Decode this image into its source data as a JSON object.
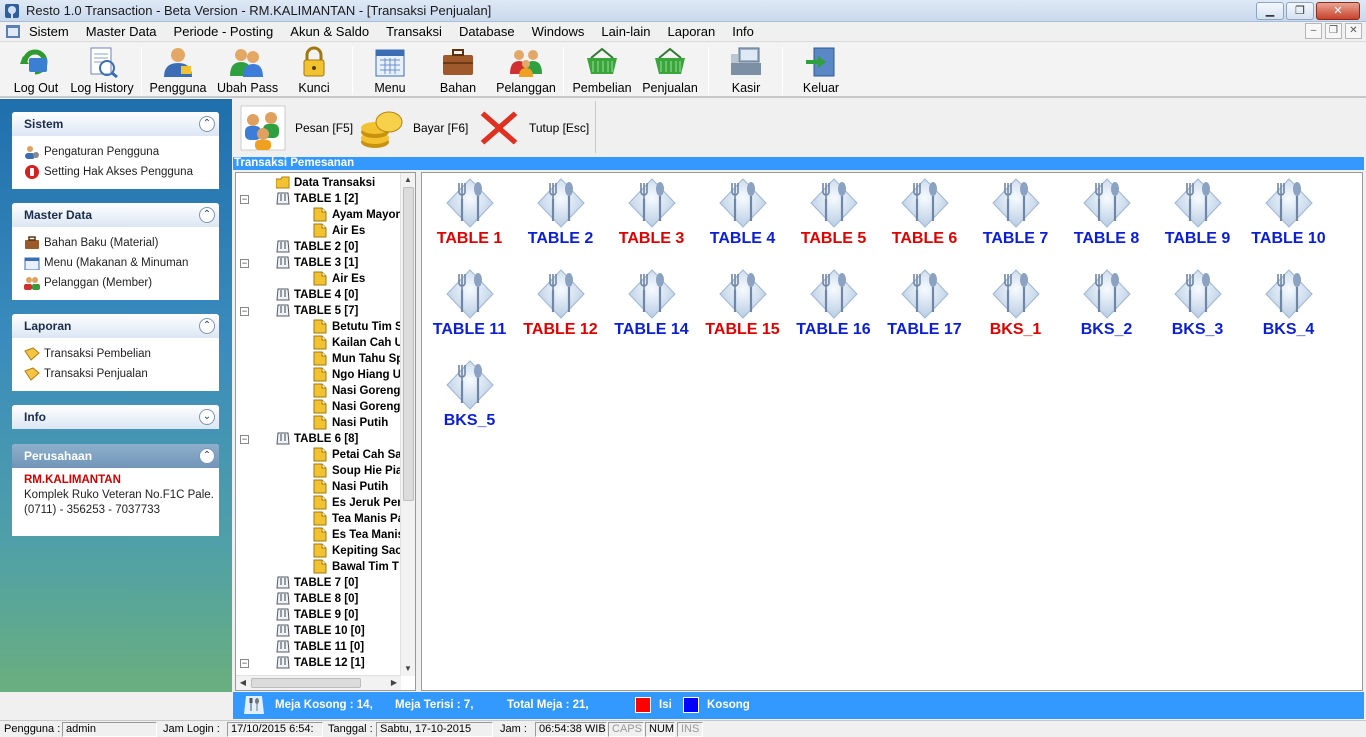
{
  "window": {
    "title": "Resto 1.0 Transaction - Beta Version - RM.KALIMANTAN - [Transaksi Penjualan]",
    "minimize": "▁",
    "maximize": "❐",
    "close": "✕"
  },
  "menu": {
    "items": [
      "Sistem",
      "Master Data",
      "Periode - Posting",
      "Akun & Saldo",
      "Transaksi",
      "Database",
      "Windows",
      "Lain-lain",
      "Laporan",
      "Info"
    ],
    "mdi_minimize": "–",
    "mdi_restore": "❐",
    "mdi_close": "✕"
  },
  "toolbar": {
    "buttons": [
      {
        "label": "Log Out",
        "icon": "logout-icon"
      },
      {
        "label": "Log History",
        "icon": "log-history-icon"
      },
      {
        "label": "Pengguna",
        "icon": "user-icon"
      },
      {
        "label": "Ubah Pass",
        "icon": "change-password-icon"
      },
      {
        "label": "Kunci",
        "icon": "lock-icon"
      },
      {
        "label": "Menu",
        "icon": "calendar-icon"
      },
      {
        "label": "Bahan",
        "icon": "briefcase-icon"
      },
      {
        "label": "Pelanggan",
        "icon": "customers-icon"
      },
      {
        "label": "Pembelian",
        "icon": "basket-icon"
      },
      {
        "label": "Penjualan",
        "icon": "basket-icon"
      },
      {
        "label": "Kasir",
        "icon": "cashier-icon"
      },
      {
        "label": "Keluar",
        "icon": "exit-door-icon"
      }
    ]
  },
  "sidebar": {
    "sistem": {
      "title": "Sistem",
      "chevron": "⌃",
      "items": [
        "Pengaturan Pengguna",
        "Setting Hak Akses Pengguna"
      ]
    },
    "master": {
      "title": "Master Data",
      "chevron": "⌃",
      "items": [
        "Bahan Baku (Material)",
        "Menu (Makanan & Minuman",
        "Pelanggan (Member)"
      ]
    },
    "laporan": {
      "title": "Laporan",
      "chevron": "⌃",
      "items": [
        "Transaksi Pembelian",
        "Transaksi Penjualan"
      ]
    },
    "info": {
      "title": "Info",
      "chevron": "⌄"
    },
    "perusahaan": {
      "title": "Perusahaan",
      "chevron": "⌃",
      "name": "RM.KALIMANTAN",
      "address": "Komplek Ruko Veteran No.F1C Pale...",
      "phone": "(0711) - 356253 - 7037733"
    }
  },
  "actions": {
    "pesan": "Pesan [F5]",
    "bayar": "Bayar [F6]",
    "tutup": "Tutup [Esc]"
  },
  "section_title": "Transaksi Pemesanan",
  "tree": {
    "root": "Data Transaksi",
    "rows": [
      {
        "label": "TABLE 1  [2]",
        "level": 1,
        "expander": "−"
      },
      {
        "label": "Ayam Mayon",
        "level": 2
      },
      {
        "label": "Air Es",
        "level": 2
      },
      {
        "label": "TABLE 2  [0]",
        "level": 1
      },
      {
        "label": "TABLE 3  [1]",
        "level": 1,
        "expander": "−"
      },
      {
        "label": "Air Es",
        "level": 2
      },
      {
        "label": "TABLE 4  [0]",
        "level": 1
      },
      {
        "label": "TABLE 5  [7]",
        "level": 1,
        "expander": "−"
      },
      {
        "label": "Betutu Tim S",
        "level": 2
      },
      {
        "label": "Kailan Cah U",
        "level": 2
      },
      {
        "label": "Mun Tahu Sp",
        "level": 2
      },
      {
        "label": "Ngo Hiang Ud",
        "level": 2
      },
      {
        "label": "Nasi Goreng",
        "level": 2
      },
      {
        "label": "Nasi Goreng",
        "level": 2
      },
      {
        "label": "Nasi Putih",
        "level": 2
      },
      {
        "label": "TABLE 6  [8]",
        "level": 1,
        "expander": "−"
      },
      {
        "label": "Petai Cah Sa",
        "level": 2
      },
      {
        "label": "Soup Hie Pia",
        "level": 2
      },
      {
        "label": "Nasi Putih",
        "level": 2
      },
      {
        "label": "Es Jeruk Per",
        "level": 2
      },
      {
        "label": "Tea Manis Pa",
        "level": 2
      },
      {
        "label": "Es Tea Manis",
        "level": 2
      },
      {
        "label": "Kepiting Sao",
        "level": 2
      },
      {
        "label": "Bawal Tim T",
        "level": 2
      },
      {
        "label": "TABLE 7  [0]",
        "level": 1
      },
      {
        "label": "TABLE 8  [0]",
        "level": 1
      },
      {
        "label": "TABLE 9  [0]",
        "level": 1
      },
      {
        "label": "TABLE 10  [0]",
        "level": 1
      },
      {
        "label": "TABLE 11  [0]",
        "level": 1
      },
      {
        "label": "TABLE 12  [1]",
        "level": 1,
        "expander": "−"
      }
    ]
  },
  "tables": [
    {
      "name": "TABLE 1",
      "status": "occupied"
    },
    {
      "name": "TABLE 2",
      "status": "empty"
    },
    {
      "name": "TABLE 3",
      "status": "occupied"
    },
    {
      "name": "TABLE 4",
      "status": "empty"
    },
    {
      "name": "TABLE 5",
      "status": "occupied"
    },
    {
      "name": "TABLE 6",
      "status": "occupied"
    },
    {
      "name": "TABLE 7",
      "status": "empty"
    },
    {
      "name": "TABLE 8",
      "status": "empty"
    },
    {
      "name": "TABLE 9",
      "status": "empty"
    },
    {
      "name": "TABLE 10",
      "status": "empty"
    },
    {
      "name": "TABLE 11",
      "status": "empty"
    },
    {
      "name": "TABLE 12",
      "status": "occupied"
    },
    {
      "name": "TABLE 14",
      "status": "empty"
    },
    {
      "name": "TABLE 15",
      "status": "occupied"
    },
    {
      "name": "TABLE 16",
      "status": "empty"
    },
    {
      "name": "TABLE 17",
      "status": "empty"
    },
    {
      "name": "BKS_1",
      "status": "occupied"
    },
    {
      "name": "BKS_2",
      "status": "empty"
    },
    {
      "name": "BKS_3",
      "status": "empty"
    },
    {
      "name": "BKS_4",
      "status": "empty"
    },
    {
      "name": "BKS_5",
      "status": "empty"
    }
  ],
  "summary": {
    "empty": "Meja Kosong : 14,",
    "filled": "Meja Terisi : 7,",
    "total": "Total Meja : 21,",
    "legend_filled": "Isi",
    "legend_empty": "Kosong",
    "color_filled": "#ff0000",
    "color_empty": "#0000ff"
  },
  "status": {
    "user_label": "Pengguna :",
    "user": "admin",
    "login_label": "Jam Login :",
    "login": "17/10/2015 6:54:",
    "date_label": "Tanggal :",
    "date": "Sabtu, 17-10-2015",
    "time_label": "Jam :",
    "time": "06:54:38 WIB",
    "caps": "CAPS",
    "num": "NUM",
    "ins": "INS"
  },
  "colors": {
    "occupied": "#e00000",
    "empty": "#0a1ed8",
    "accent": "#3399ff"
  }
}
